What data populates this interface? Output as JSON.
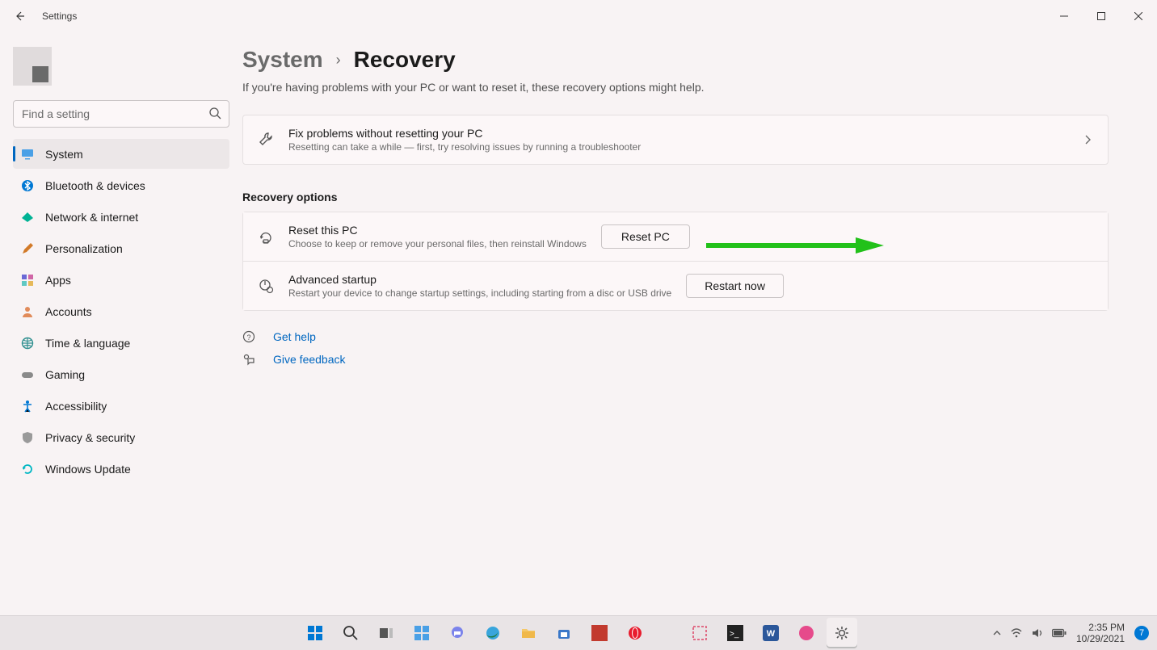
{
  "app_title": "Settings",
  "search": {
    "placeholder": "Find a setting"
  },
  "nav": {
    "items": [
      {
        "label": "System"
      },
      {
        "label": "Bluetooth & devices"
      },
      {
        "label": "Network & internet"
      },
      {
        "label": "Personalization"
      },
      {
        "label": "Apps"
      },
      {
        "label": "Accounts"
      },
      {
        "label": "Time & language"
      },
      {
        "label": "Gaming"
      },
      {
        "label": "Accessibility"
      },
      {
        "label": "Privacy & security"
      },
      {
        "label": "Windows Update"
      }
    ]
  },
  "breadcrumb": {
    "parent": "System",
    "current": "Recovery"
  },
  "subdesc": "If you're having problems with your PC or want to reset it, these recovery options might help.",
  "troubleshoot_card": {
    "title": "Fix problems without resetting your PC",
    "sub": "Resetting can take a while — first, try resolving issues by running a troubleshooter"
  },
  "section_title": "Recovery options",
  "options": {
    "reset": {
      "title": "Reset this PC",
      "sub": "Choose to keep or remove your personal files, then reinstall Windows",
      "button": "Reset PC"
    },
    "advanced": {
      "title": "Advanced startup",
      "sub": "Restart your device to change startup settings, including starting from a disc or USB drive",
      "button": "Restart now"
    }
  },
  "help": {
    "get_help": "Get help",
    "feedback": "Give feedback"
  },
  "taskbar": {
    "time": "2:35 PM",
    "date": "10/29/2021",
    "notif_count": "7"
  }
}
